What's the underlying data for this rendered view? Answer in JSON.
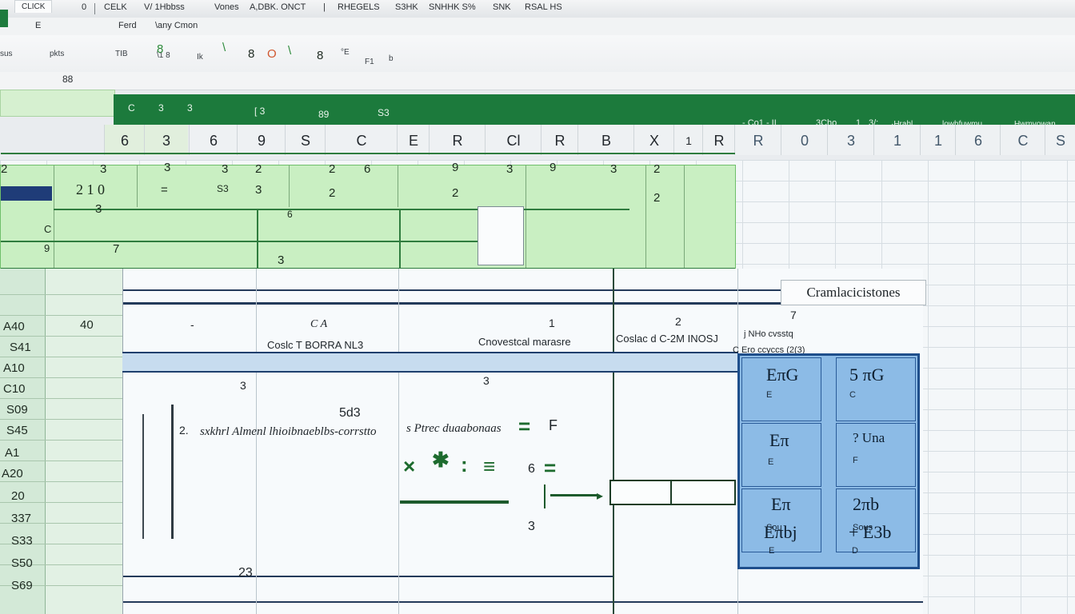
{
  "titlebar": {
    "tabs": [
      "CLICK",
      "0",
      "CELK",
      "V/ 1Hbbss",
      "Vones",
      "A,DBK. ONCT",
      "|",
      "RHEGELS",
      "S3HK",
      "SNHHK S%",
      "SNK",
      "RSAL HS"
    ]
  },
  "subtabs": [
    "E",
    "Ferd",
    "\\any Cmon"
  ],
  "ribbon": {
    "left_labels": [
      "sus",
      "pkts",
      "TIB",
      "\\1 8",
      "Ik"
    ],
    "icons": [
      "8",
      "\\",
      "8",
      "O",
      "\\",
      "8"
    ],
    "right_labels": [
      "°E",
      "F1",
      "b"
    ]
  },
  "name_box": "88",
  "green_band": {
    "items": [
      "C",
      "3",
      "3",
      "[ 3",
      "89",
      "S3"
    ],
    "right": [
      "- Co1 - II",
      "3Cho",
      "1",
      "3/:",
      "·Hrahl",
      "lowhfuwmu",
      "Hwmvowan"
    ]
  },
  "columns": [
    "6",
    "3",
    "6",
    "9",
    "S",
    "C",
    "E",
    "R",
    "Cl",
    "R",
    "B",
    "X",
    "1",
    "R",
    "R",
    "0",
    "3",
    "1",
    "1",
    "6",
    "C",
    "S"
  ],
  "green_grid": {
    "cells": [
      "2",
      "3",
      "3",
      "3",
      "2",
      "2",
      "6",
      "9",
      "3",
      "9",
      "3",
      "2",
      "=",
      "S3",
      "3",
      "2",
      "2",
      "2",
      "3",
      "6",
      "C",
      "9",
      "7",
      "3"
    ],
    "left_marker": "2 1 0"
  },
  "row_headers": [
    "A40",
    "S41",
    "A10",
    "C10",
    "S09",
    "S45",
    "A1",
    "A20",
    "20",
    "337",
    "S33",
    "S50",
    "S69"
  ],
  "row_header_sub": [
    "40"
  ],
  "panel": {
    "title_badge": "Cramlacicistones",
    "header_row": [
      "-",
      "C A",
      "1",
      "2",
      "7"
    ],
    "header_labels": [
      "Coslc T BORRA NL3",
      "Cnovestcal marasre",
      "Coslac d C-2M INOSJ",
      "j NHo cvsstq",
      "C Ero ccyccs (2(3)"
    ],
    "body": [
      "3",
      "3",
      "5d3",
      "2.",
      "sxkhrl Almenl lhioibnaeblbs-corrstto",
      "s Ptrec duaabonaas",
      "F",
      "6",
      "3",
      "23"
    ]
  },
  "calc_card": {
    "cells": [
      {
        "big": "EπG",
        "small": "E"
      },
      {
        "big": "5 πG",
        "small": "C"
      },
      {
        "big": "Eπ",
        "small": "E"
      },
      {
        "big": "? Una",
        "small": "F"
      },
      {
        "big": "Eπ",
        "small": "Sou"
      },
      {
        "big": "2πb",
        "small": "Sous"
      },
      {
        "big": "Eπbj",
        "small": "E"
      },
      {
        "big": "+ E3b",
        "small": "D"
      }
    ]
  }
}
